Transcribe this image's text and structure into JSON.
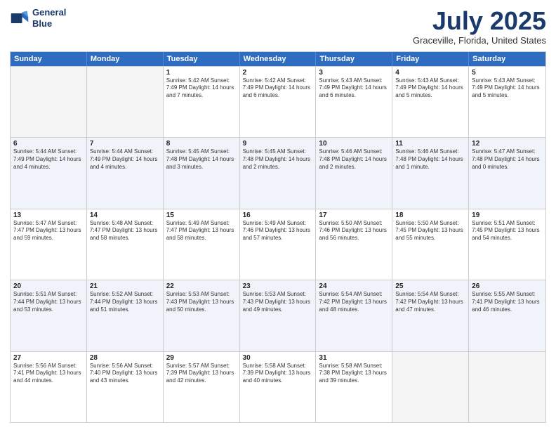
{
  "header": {
    "logo_line1": "General",
    "logo_line2": "Blue",
    "month": "July 2025",
    "location": "Graceville, Florida, United States"
  },
  "weekdays": [
    "Sunday",
    "Monday",
    "Tuesday",
    "Wednesday",
    "Thursday",
    "Friday",
    "Saturday"
  ],
  "rows": [
    {
      "cells": [
        {
          "day": "",
          "text": "",
          "empty": true
        },
        {
          "day": "",
          "text": "",
          "empty": true
        },
        {
          "day": "1",
          "text": "Sunrise: 5:42 AM\nSunset: 7:49 PM\nDaylight: 14 hours and 7 minutes."
        },
        {
          "day": "2",
          "text": "Sunrise: 5:42 AM\nSunset: 7:49 PM\nDaylight: 14 hours and 6 minutes."
        },
        {
          "day": "3",
          "text": "Sunrise: 5:43 AM\nSunset: 7:49 PM\nDaylight: 14 hours and 6 minutes."
        },
        {
          "day": "4",
          "text": "Sunrise: 5:43 AM\nSunset: 7:49 PM\nDaylight: 14 hours and 5 minutes."
        },
        {
          "day": "5",
          "text": "Sunrise: 5:43 AM\nSunset: 7:49 PM\nDaylight: 14 hours and 5 minutes."
        }
      ]
    },
    {
      "cells": [
        {
          "day": "6",
          "text": "Sunrise: 5:44 AM\nSunset: 7:49 PM\nDaylight: 14 hours and 4 minutes."
        },
        {
          "day": "7",
          "text": "Sunrise: 5:44 AM\nSunset: 7:49 PM\nDaylight: 14 hours and 4 minutes."
        },
        {
          "day": "8",
          "text": "Sunrise: 5:45 AM\nSunset: 7:48 PM\nDaylight: 14 hours and 3 minutes."
        },
        {
          "day": "9",
          "text": "Sunrise: 5:45 AM\nSunset: 7:48 PM\nDaylight: 14 hours and 2 minutes."
        },
        {
          "day": "10",
          "text": "Sunrise: 5:46 AM\nSunset: 7:48 PM\nDaylight: 14 hours and 2 minutes."
        },
        {
          "day": "11",
          "text": "Sunrise: 5:46 AM\nSunset: 7:48 PM\nDaylight: 14 hours and 1 minute."
        },
        {
          "day": "12",
          "text": "Sunrise: 5:47 AM\nSunset: 7:48 PM\nDaylight: 14 hours and 0 minutes."
        }
      ]
    },
    {
      "cells": [
        {
          "day": "13",
          "text": "Sunrise: 5:47 AM\nSunset: 7:47 PM\nDaylight: 13 hours and 59 minutes."
        },
        {
          "day": "14",
          "text": "Sunrise: 5:48 AM\nSunset: 7:47 PM\nDaylight: 13 hours and 58 minutes."
        },
        {
          "day": "15",
          "text": "Sunrise: 5:49 AM\nSunset: 7:47 PM\nDaylight: 13 hours and 58 minutes."
        },
        {
          "day": "16",
          "text": "Sunrise: 5:49 AM\nSunset: 7:46 PM\nDaylight: 13 hours and 57 minutes."
        },
        {
          "day": "17",
          "text": "Sunrise: 5:50 AM\nSunset: 7:46 PM\nDaylight: 13 hours and 56 minutes."
        },
        {
          "day": "18",
          "text": "Sunrise: 5:50 AM\nSunset: 7:45 PM\nDaylight: 13 hours and 55 minutes."
        },
        {
          "day": "19",
          "text": "Sunrise: 5:51 AM\nSunset: 7:45 PM\nDaylight: 13 hours and 54 minutes."
        }
      ]
    },
    {
      "cells": [
        {
          "day": "20",
          "text": "Sunrise: 5:51 AM\nSunset: 7:44 PM\nDaylight: 13 hours and 53 minutes."
        },
        {
          "day": "21",
          "text": "Sunrise: 5:52 AM\nSunset: 7:44 PM\nDaylight: 13 hours and 51 minutes."
        },
        {
          "day": "22",
          "text": "Sunrise: 5:53 AM\nSunset: 7:43 PM\nDaylight: 13 hours and 50 minutes."
        },
        {
          "day": "23",
          "text": "Sunrise: 5:53 AM\nSunset: 7:43 PM\nDaylight: 13 hours and 49 minutes."
        },
        {
          "day": "24",
          "text": "Sunrise: 5:54 AM\nSunset: 7:42 PM\nDaylight: 13 hours and 48 minutes."
        },
        {
          "day": "25",
          "text": "Sunrise: 5:54 AM\nSunset: 7:42 PM\nDaylight: 13 hours and 47 minutes."
        },
        {
          "day": "26",
          "text": "Sunrise: 5:55 AM\nSunset: 7:41 PM\nDaylight: 13 hours and 46 minutes."
        }
      ]
    },
    {
      "cells": [
        {
          "day": "27",
          "text": "Sunrise: 5:56 AM\nSunset: 7:41 PM\nDaylight: 13 hours and 44 minutes."
        },
        {
          "day": "28",
          "text": "Sunrise: 5:56 AM\nSunset: 7:40 PM\nDaylight: 13 hours and 43 minutes."
        },
        {
          "day": "29",
          "text": "Sunrise: 5:57 AM\nSunset: 7:39 PM\nDaylight: 13 hours and 42 minutes."
        },
        {
          "day": "30",
          "text": "Sunrise: 5:58 AM\nSunset: 7:39 PM\nDaylight: 13 hours and 40 minutes."
        },
        {
          "day": "31",
          "text": "Sunrise: 5:58 AM\nSunset: 7:38 PM\nDaylight: 13 hours and 39 minutes."
        },
        {
          "day": "",
          "text": "",
          "empty": true
        },
        {
          "day": "",
          "text": "",
          "empty": true
        }
      ]
    }
  ]
}
